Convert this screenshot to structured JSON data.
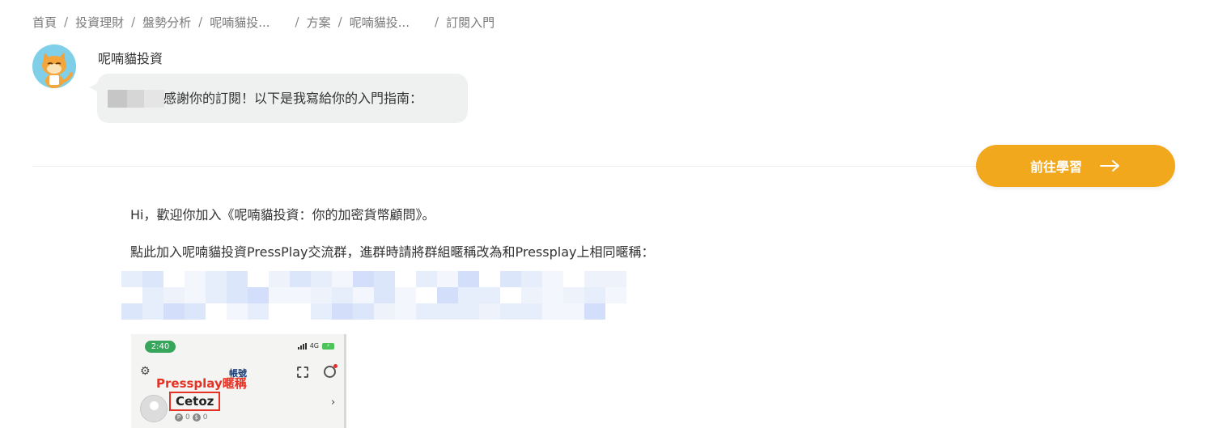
{
  "breadcrumb": {
    "items": [
      "首頁",
      "投資理財",
      "盤勢分析",
      "呢喃貓投...",
      "方案",
      "呢喃貓投...",
      "訂閱入門"
    ],
    "separator": "/"
  },
  "author": {
    "name": "呢喃貓投資",
    "avatar_icon": "cat-avatar-icon"
  },
  "welcome_bubble": {
    "text": "感謝你的訂閱！以下是我寫給你的入門指南："
  },
  "cta": {
    "label": "前往學習",
    "icon": "arrow-right-icon",
    "color": "#f2a81d"
  },
  "content": {
    "paragraph_1": "Hi，歡迎你加入《呢喃貓投資：你的加密貨幣顧問》。",
    "paragraph_2": "點此加入呢喃貓投資PressPlay交流群，進群時請將群組暱稱改為和Pressplay上相同暱稱："
  },
  "phone_screenshot": {
    "time": "2:40",
    "network": "4G",
    "annotation_nickname": "Pressplay暱稱",
    "annotation_account": "帳號",
    "nickname": "Cetoz",
    "points": [
      "0",
      "0"
    ],
    "chevron": "›"
  }
}
